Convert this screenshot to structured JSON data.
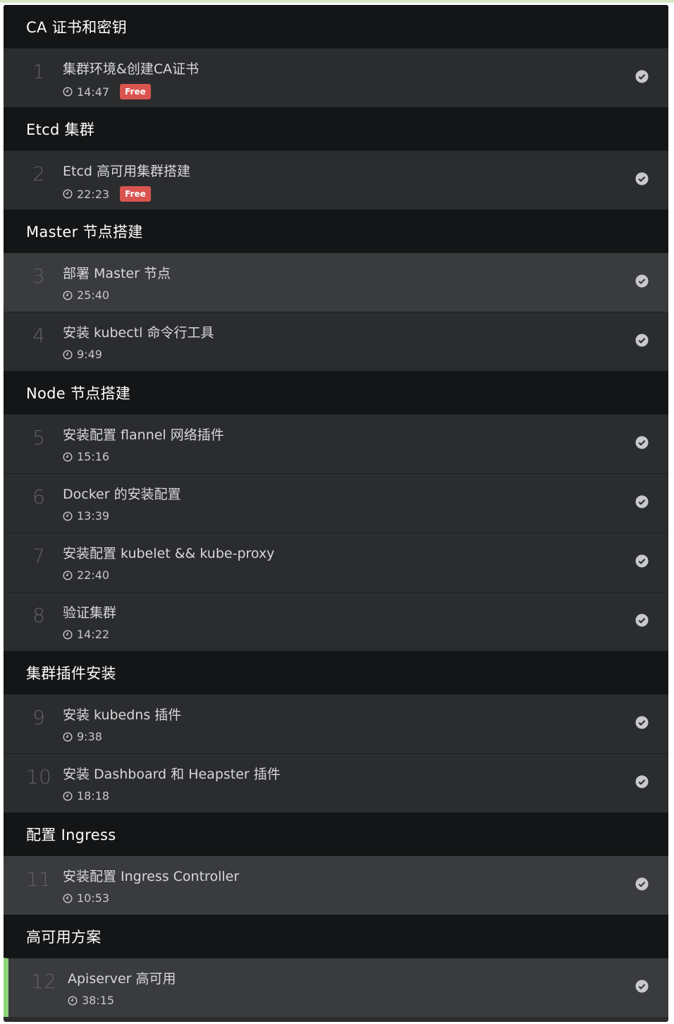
{
  "sections": [
    {
      "title": "CA 证书和密钥",
      "lessons": [
        {
          "num": "1",
          "title": "集群环境&创建CA证书",
          "duration": "14:47",
          "free": "Free"
        }
      ]
    },
    {
      "title": "Etcd 集群",
      "lessons": [
        {
          "num": "2",
          "title": "Etcd 高可用集群搭建",
          "duration": "22:23",
          "free": "Free"
        }
      ]
    },
    {
      "title": "Master 节点搭建",
      "lessons": [
        {
          "num": "3",
          "title": "部署 Master 节点",
          "duration": "25:40"
        },
        {
          "num": "4",
          "title": "安装 kubectl 命令行工具",
          "duration": "9:49"
        }
      ]
    },
    {
      "title": "Node 节点搭建",
      "lessons": [
        {
          "num": "5",
          "title": "安装配置 flannel 网络插件",
          "duration": "15:16"
        },
        {
          "num": "6",
          "title": "Docker 的安装配置",
          "duration": "13:39"
        },
        {
          "num": "7",
          "title": "安装配置 kubelet && kube-proxy",
          "duration": "22:40"
        },
        {
          "num": "8",
          "title": "验证集群",
          "duration": "14:22"
        }
      ]
    },
    {
      "title": "集群插件安装",
      "lessons": [
        {
          "num": "9",
          "title": "安装 kubedns 插件",
          "duration": "9:38"
        },
        {
          "num": "10",
          "title": "安装 Dashboard 和 Heapster 插件",
          "duration": "18:18"
        }
      ]
    },
    {
      "title": "配置 Ingress",
      "lessons": [
        {
          "num": "11",
          "title": "安装配置 Ingress Controller",
          "duration": "10:53"
        }
      ]
    },
    {
      "title": "高可用方案",
      "lessons": [
        {
          "num": "12",
          "title": "Apiserver 高可用",
          "duration": "38:15"
        }
      ]
    }
  ],
  "icons": {
    "completed": "check-circle-icon",
    "duration": "clock-icon"
  },
  "colors": {
    "section_bg": "#141516",
    "lesson_bg": "#2b2c2e",
    "highlight_bg": "#3a3b3d",
    "free_badge": "#d9534f",
    "current_marker": "#8fd37a",
    "check": "#c8c9cb"
  }
}
